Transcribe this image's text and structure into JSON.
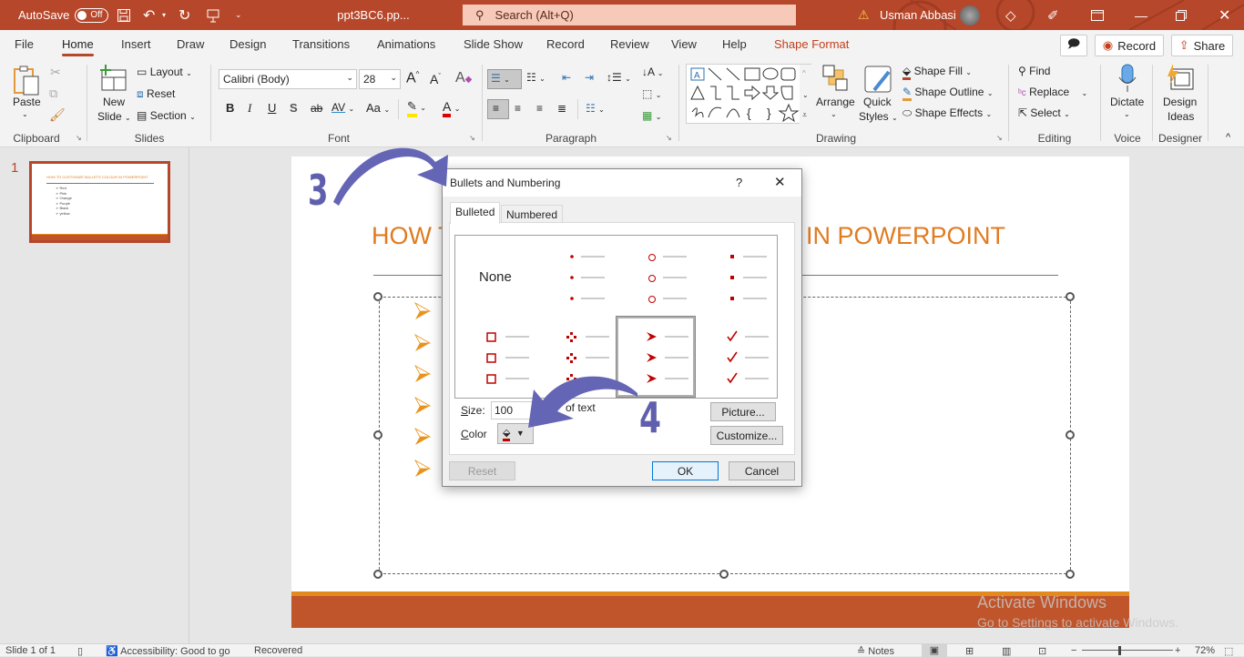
{
  "titlebar": {
    "autosave_label": "AutoSave",
    "autosave_state": "Off",
    "filename": "ppt3BC6.pp...",
    "search_placeholder": "Search (Alt+Q)",
    "user_name": "Usman Abbasi",
    "accent": "#b7472a"
  },
  "tabs": [
    {
      "label": "File"
    },
    {
      "label": "Home",
      "active": true
    },
    {
      "label": "Insert"
    },
    {
      "label": "Draw"
    },
    {
      "label": "Design"
    },
    {
      "label": "Transitions"
    },
    {
      "label": "Animations"
    },
    {
      "label": "Slide Show"
    },
    {
      "label": "Record"
    },
    {
      "label": "Review"
    },
    {
      "label": "View"
    },
    {
      "label": "Help"
    },
    {
      "label": "Shape Format",
      "contextual": true
    }
  ],
  "tab_right": {
    "record_label": "Record",
    "share_label": "Share"
  },
  "ribbon": {
    "clipboard": {
      "label": "Clipboard",
      "paste": "Paste"
    },
    "slides": {
      "label": "Slides",
      "new_slide_1": "New",
      "new_slide_2": "Slide",
      "layout": "Layout",
      "reset": "Reset",
      "section": "Section"
    },
    "font": {
      "label": "Font",
      "font_name": "Calibri (Body)",
      "font_size": "28",
      "bold": "B",
      "italic": "I",
      "underline": "U",
      "shadow": "S",
      "strike": "ab",
      "spacing": "AV",
      "case": "Aa"
    },
    "paragraph": {
      "label": "Paragraph"
    },
    "drawing": {
      "label": "Drawing",
      "arrange": "Arrange",
      "quick_styles_1": "Quick",
      "quick_styles_2": "Styles",
      "shape_fill": "Shape Fill",
      "shape_outline": "Shape Outline",
      "shape_effects": "Shape Effects"
    },
    "editing": {
      "label": "Editing",
      "find": "Find",
      "replace": "Replace",
      "select": "Select"
    },
    "voice": {
      "label": "Voice",
      "dictate": "Dictate"
    },
    "designer": {
      "label": "Designer",
      "design_ideas_1": "Design",
      "design_ideas_2": "Ideas"
    }
  },
  "thumbnails": {
    "slide_number": "1",
    "thumb_title": "HOW TO CUSTOMIZE BULLETS COLOUR IN POWERPOINT",
    "thumb_items": [
      "Red",
      "Pink",
      "Orange",
      "Purple",
      "Black",
      "yellow"
    ]
  },
  "slide": {
    "title_left": "HOW T",
    "title_right": "IN POWERPOINT",
    "title_color": "#e07b21",
    "bullet_count": 6,
    "bullet_color": "#e8931e",
    "footer_color": "#c0542a"
  },
  "dialog": {
    "title": "Bullets and Numbering",
    "help": "?",
    "tabs": [
      {
        "label": "Bulleted",
        "active": true
      },
      {
        "label": "Numbered"
      }
    ],
    "gallery_none": "None",
    "gallery_selected": "arrow-bullets",
    "bullet_color": "#c00000",
    "size_label": "Size:",
    "size_value": "100",
    "size_suffix": "of text",
    "color_label": "Color",
    "picture_button": "Picture...",
    "customize_button": "Customize...",
    "reset_button": "Reset",
    "ok_button": "OK",
    "cancel_button": "Cancel"
  },
  "annotations": {
    "step_3": "3",
    "step_4": "4",
    "color": "#5f5fae"
  },
  "watermark": {
    "line1": "Activate Windows",
    "line2": "Go to Settings to activate Windows."
  },
  "statusbar": {
    "slide_info": "Slide 1 of 1",
    "accessibility": "Accessibility: Good to go",
    "recovered": "Recovered",
    "notes": "Notes",
    "zoom": "72%",
    "zoom_fraction": 0.4
  }
}
